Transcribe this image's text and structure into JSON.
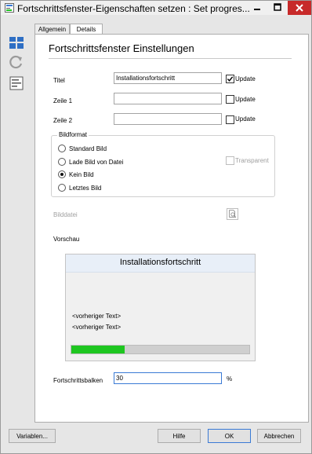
{
  "window": {
    "title": "Fortschrittsfenster-Eigenschaften setzen : Set progres..."
  },
  "sidebar": {
    "icons": [
      "layout-icon",
      "reset-icon",
      "properties-icon"
    ]
  },
  "tabs": [
    {
      "label": "Allgemein",
      "active": false
    },
    {
      "label": "Details",
      "active": true
    }
  ],
  "section": {
    "heading": "Fortschrittsfenster Einstellungen"
  },
  "fields": {
    "titel": {
      "label": "Titel",
      "value": "Installationsfortschritt",
      "update_label": "Update",
      "update_checked": true
    },
    "zeile1": {
      "label": "Zeile 1",
      "value": "",
      "update_label": "Update",
      "update_checked": false
    },
    "zeile2": {
      "label": "Zeile 2",
      "value": "",
      "update_label": "Update",
      "update_checked": false
    }
  },
  "bildformat": {
    "title": "Bildformat",
    "options": [
      "Standard Bild",
      "Lade Bild von Datei",
      "Kein Bild",
      "Letztes Bild"
    ],
    "selected": "Kein Bild",
    "transparent_label": "Transparent",
    "transparent_checked": false
  },
  "bilddatei": {
    "label": "Bilddatei"
  },
  "vorschau": {
    "label": "Vorschau",
    "title": "Installationsfortschritt",
    "line1": "<vorheriger Text>",
    "line2": "<vorheriger Text>",
    "progress_fraction": 0.3
  },
  "fortschritt": {
    "label": "Fortschrittsbalken",
    "value": "30",
    "unit": "%"
  },
  "buttons": {
    "variables": "Variablen...",
    "help": "Hilfe",
    "ok": "OK",
    "cancel": "Abbrechen"
  },
  "colors": {
    "accent": "#3a7ad5",
    "progress": "#1ec620",
    "close": "#c72a2a"
  }
}
